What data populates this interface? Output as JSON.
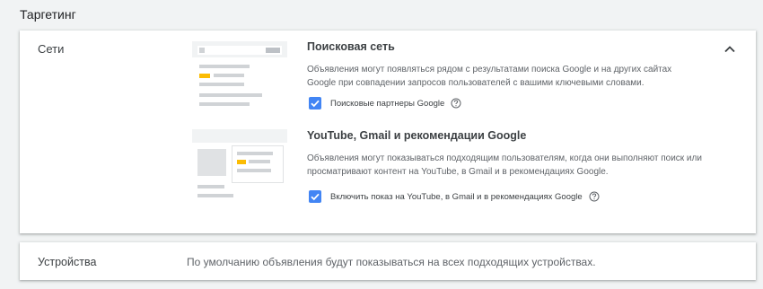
{
  "section": {
    "title": "Таргетинг"
  },
  "networks": {
    "label": "Сети",
    "search_network": {
      "title": "Поисковая сеть",
      "description": "Объявления могут появляться рядом с результатами поиска Google и на других сайтах Google при совпадении запросов пользователей с вашими ключевыми словами.",
      "checkbox_label": "Поисковые партнеры Google",
      "checked": true
    },
    "display_network": {
      "title": "YouTube, Gmail и рекомендации Google",
      "description": "Объявления могут показываться подходящим пользователям, когда они выполняют поиск или просматривают контент на YouTube, в Gmail и в рекомендациях Google.",
      "checkbox_label": "Включить показ на YouTube, в Gmail и в рекомендациях Google",
      "checked": true
    }
  },
  "devices": {
    "label": "Устройства",
    "value": "По умолчанию объявления будут показываться на всех подходящих устройствах."
  },
  "icons": {
    "collapse": "chevron-up-icon",
    "help": "help-circle-icon",
    "check": "check-icon"
  },
  "colors": {
    "checkbox": "#4285f4",
    "accent_yellow": "#fbbc04",
    "background": "#f1f3f4"
  }
}
